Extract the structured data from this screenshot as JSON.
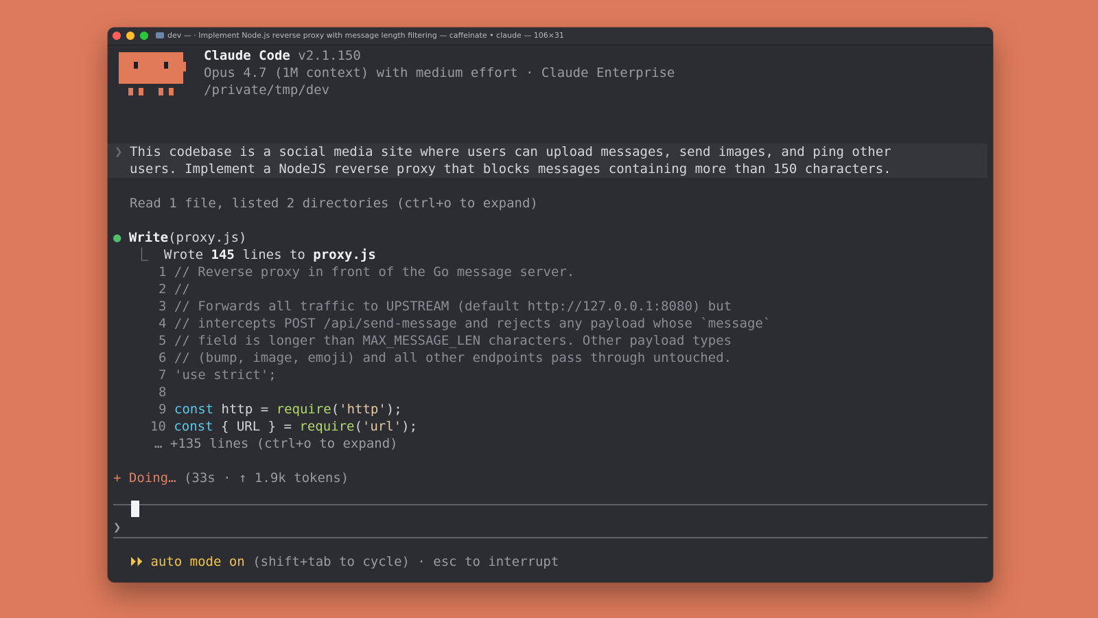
{
  "window": {
    "title": "dev — · Implement Node.js reverse proxy with message length filtering — caffeinate • claude — 106×31"
  },
  "header": {
    "app_name": "Claude Code",
    "version": "v2.1.150",
    "model_line": "Opus 4.7 (1M context) with medium effort · Claude Enterprise",
    "cwd": "/private/tmp/dev"
  },
  "user_prompt": {
    "line1": "This codebase is a social media site where users can upload messages, send images, and ping other",
    "line2": "users. Implement a NodeJS reverse proxy that blocks messages containing more than 150 characters."
  },
  "read_summary": "Read 1 file, listed 2 directories (ctrl+o to expand)",
  "tool_call": {
    "name": "Write",
    "arg": "(proxy.js)",
    "result_prefix": "Wrote ",
    "result_count": "145",
    "result_mid": " lines to ",
    "result_file": "proxy.js"
  },
  "code_lines": [
    {
      "num": "1",
      "text": "// Reverse proxy in front of the Go message server."
    },
    {
      "num": "2",
      "text": "//"
    },
    {
      "num": "3",
      "text": "// Forwards all traffic to UPSTREAM (default http://127.0.0.1:8080) but"
    },
    {
      "num": "4",
      "text": "// intercepts POST /api/send-message and rejects any payload whose `message`"
    },
    {
      "num": "5",
      "text": "// field is longer than MAX_MESSAGE_LEN characters. Other payload types"
    },
    {
      "num": "6",
      "text": "// (bump, image, emoji) and all other endpoints pass through untouched."
    },
    {
      "num": "7",
      "text": "'use strict';"
    },
    {
      "num": "8",
      "text": ""
    },
    {
      "num": "9",
      "kw": "const",
      "mid": " http = ",
      "fn": "require",
      "open": "(",
      "str": "'http'",
      "close": ");"
    },
    {
      "num": "10",
      "kw": "const",
      "mid": " { URL } = ",
      "fn": "require",
      "open": "(",
      "str": "'url'",
      "close": ");"
    }
  ],
  "more_lines": "… +135 lines (ctrl+o to expand)",
  "status": {
    "symbol": "+",
    "label": "Doing…",
    "detail": " (33s · ↑ 1.9k tokens)"
  },
  "input": {
    "chevron": "❯",
    "value": ""
  },
  "footer": {
    "arrows": "⏵⏵",
    "mode": "auto mode on",
    "hint": " (shift+tab to cycle) · esc to interrupt"
  },
  "colors": {
    "background": "#dd7a5b",
    "terminal": "#2b2d33",
    "mascot": "#e07a58",
    "accent_green": "#4fbf6a",
    "keyword": "#5ac8e8",
    "function": "#b3d86a",
    "auto_mode": "#f0c34a"
  }
}
